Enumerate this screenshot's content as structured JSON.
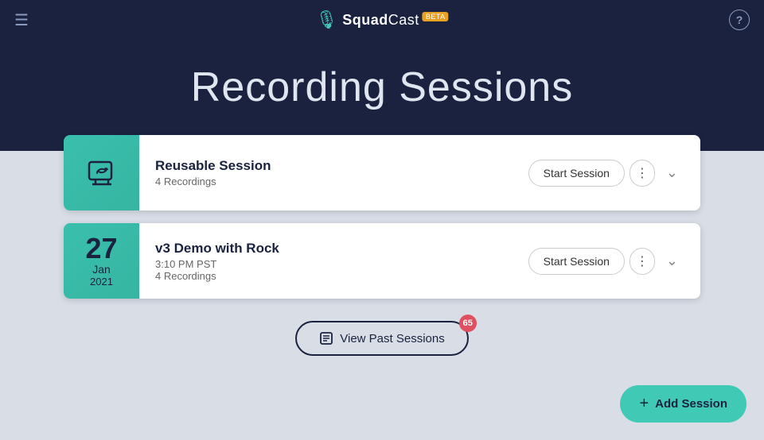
{
  "nav": {
    "menu_icon": "☰",
    "logo_bold": "Squad",
    "logo_light": "Cast",
    "beta_label": "BETA",
    "help_label": "?"
  },
  "header": {
    "title": "Recording Sessions"
  },
  "sessions": [
    {
      "id": "reusable",
      "type": "reusable",
      "name": "Reusable Session",
      "recordings": "4 Recordings",
      "start_button": "Start Session"
    },
    {
      "id": "v3-demo",
      "type": "dated",
      "day": "27",
      "month": "Jan",
      "year": "2021",
      "name": "v3 Demo with Rock",
      "time": "3:10 PM PST",
      "recordings": "4 Recordings",
      "start_button": "Start Session"
    }
  ],
  "view_past": {
    "label": "View Past Sessions",
    "badge": "65"
  },
  "add_session": {
    "label": "Add Session"
  }
}
